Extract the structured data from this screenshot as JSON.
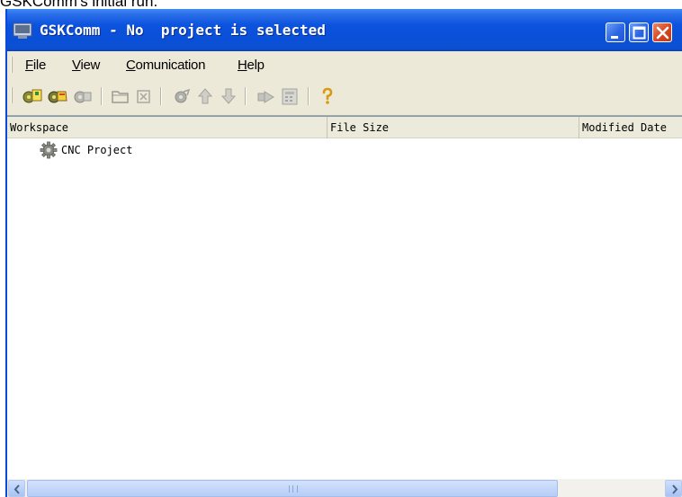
{
  "caption": "GSKComm's initial run.",
  "window": {
    "title": "GSKComm - No  project is selected",
    "controls": [
      "minimize",
      "maximize",
      "close"
    ]
  },
  "menu": {
    "items": [
      {
        "accel": "F",
        "rest": "ile"
      },
      {
        "accel": "V",
        "rest": "iew"
      },
      {
        "accel": "C",
        "rest": "omunication"
      },
      {
        "accel": "H",
        "rest": "elp"
      }
    ]
  },
  "toolbar": {
    "buttons": [
      {
        "icon": "new-project-icon",
        "enabled": true
      },
      {
        "icon": "open-project-icon",
        "enabled": true
      },
      {
        "icon": "close-project-icon",
        "enabled": false
      },
      {
        "icon": "folder-icon",
        "enabled": false
      },
      {
        "icon": "delete-icon",
        "enabled": false
      },
      {
        "icon": "settings-icon",
        "enabled": false
      },
      {
        "icon": "upload-icon",
        "enabled": false
      },
      {
        "icon": "download-icon",
        "enabled": false
      },
      {
        "icon": "run-icon",
        "enabled": false
      },
      {
        "icon": "calculator-icon",
        "enabled": false
      },
      {
        "icon": "help-icon",
        "enabled": true
      }
    ]
  },
  "list": {
    "columns": [
      "Workspace",
      "File Size",
      "Modified Date"
    ],
    "rows": [
      {
        "icon": "gear-icon",
        "label": "CNC Project"
      }
    ]
  },
  "colors": {
    "titlebar": "#0a4fd8",
    "window_face": "#ece9d8",
    "close_button": "#d6461f"
  }
}
